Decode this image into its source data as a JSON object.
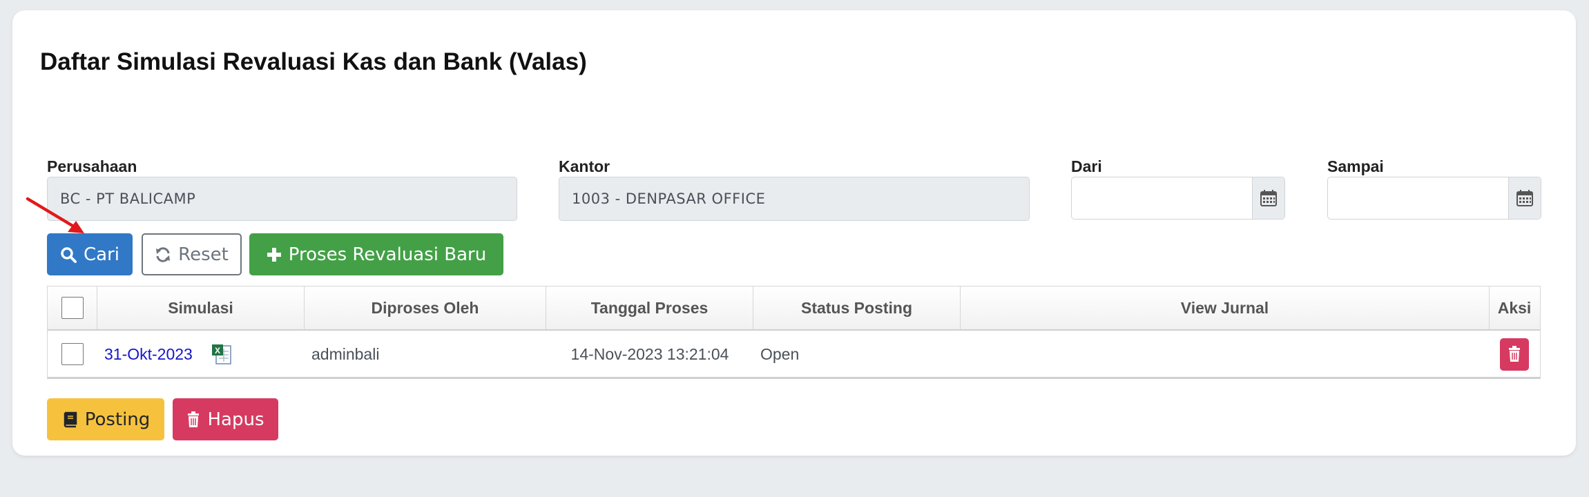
{
  "page": {
    "title": "Daftar Simulasi Revaluasi Kas dan Bank (Valas)"
  },
  "filters": {
    "perusahaan": {
      "label": "Perusahaan",
      "value": "BC - PT BALICAMP"
    },
    "kantor": {
      "label": "Kantor",
      "value": "1003 - DENPASAR OFFICE"
    },
    "dari": {
      "label": "Dari",
      "value": ""
    },
    "sampai": {
      "label": "Sampai",
      "value": ""
    }
  },
  "actions": {
    "cari": "Cari",
    "reset": "Reset",
    "proses": "Proses Revaluasi Baru"
  },
  "table": {
    "headers": [
      "Simulasi",
      "Diproses Oleh",
      "Tanggal Proses",
      "Status Posting",
      "View Jurnal",
      "Aksi"
    ],
    "rows": [
      {
        "simulasi": "31-Okt-2023",
        "diproses_oleh": "adminbali",
        "tanggal_proses": "14-Nov-2023 13:21:04",
        "status_posting": "Open",
        "view_jurnal": ""
      }
    ]
  },
  "footer_actions": {
    "posting": "Posting",
    "hapus": "Hapus"
  },
  "colors": {
    "primary": "#3178c6",
    "success": "#43a047",
    "warning": "#f6c23e",
    "danger": "#d63a61",
    "annotation_arrow": "#e0191c"
  },
  "icons": {
    "cari": "search-icon",
    "reset": "refresh-icon",
    "proses": "plus-icon",
    "posting": "book-icon",
    "hapus": "trash-icon",
    "date": "calendar-icon",
    "excel": "excel-file-icon"
  }
}
